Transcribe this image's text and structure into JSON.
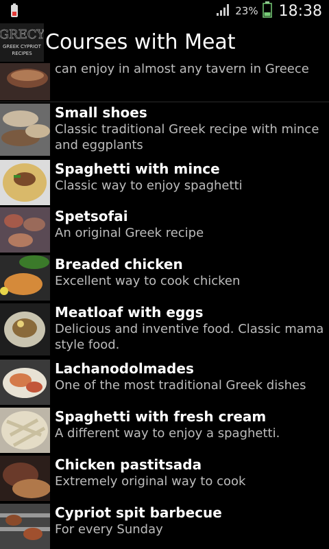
{
  "status_bar": {
    "battery_percent": "23%",
    "clock": "18:38"
  },
  "action_bar": {
    "logo_text_top": "GRECY",
    "logo_text_mid": "GREEK CYPRIOT",
    "logo_text_bottom": "RECIPES",
    "title": "Courses with Meat"
  },
  "recipes": [
    {
      "title": "",
      "desc": "One of the most famous courses which we can enjoy in almost any tavern in Greece"
    },
    {
      "title": "Small shoes",
      "desc": "Classic traditional Greek recipe with mince and eggplants"
    },
    {
      "title": "Spaghetti with mince",
      "desc": "Classic way to enjoy spaghetti"
    },
    {
      "title": "Spetsofai",
      "desc": "An original Greek recipe"
    },
    {
      "title": "Breaded chicken",
      "desc": "Excellent way to cook chicken"
    },
    {
      "title": "Meatloaf with eggs",
      "desc": "Delicious and inventive food. Classic mama style food."
    },
    {
      "title": "Lachanodolmades",
      "desc": "One of the most traditional Greek dishes"
    },
    {
      "title": "Spaghetti with fresh cream",
      "desc": "A different way to enjoy a spaghetti."
    },
    {
      "title": "Chicken pastitsada",
      "desc": "Extremely original way to cook"
    },
    {
      "title": "Cypriot spit barbecue",
      "desc": "For every Sunday"
    }
  ]
}
